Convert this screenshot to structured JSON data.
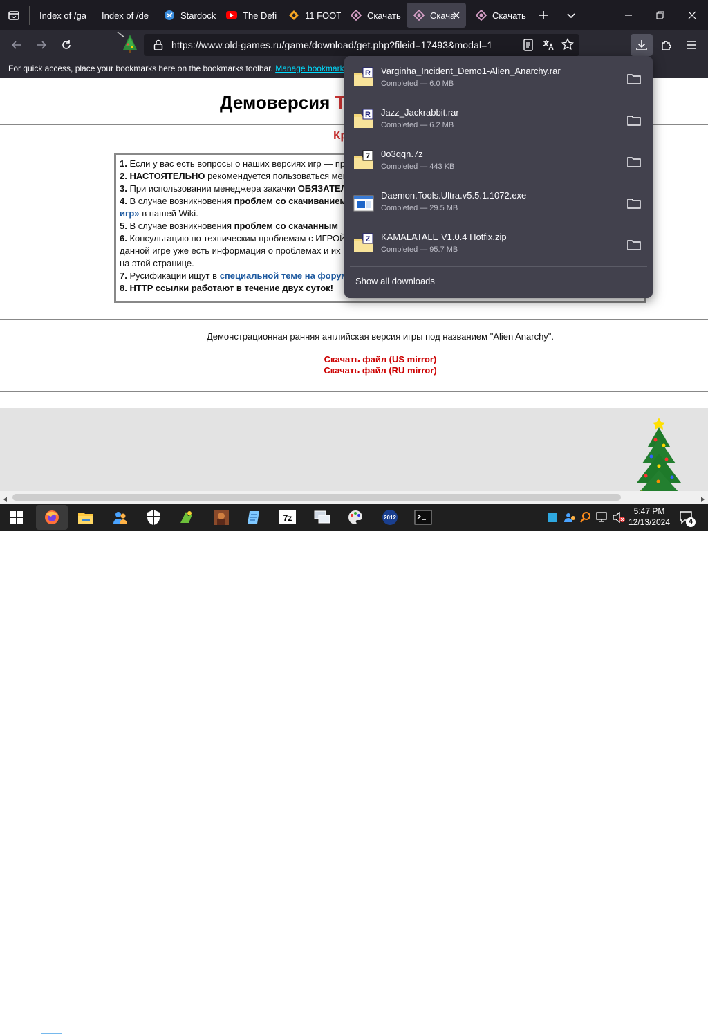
{
  "tabs": [
    {
      "label": "Index of /ga",
      "favicon": "folder-icon"
    },
    {
      "label": "Index of /de",
      "favicon": "folder-icon"
    },
    {
      "label": "Stardock",
      "favicon": "stardock-icon"
    },
    {
      "label": "The Defi",
      "favicon": "youtube-icon"
    },
    {
      "label": "11 FOOT",
      "favicon": "diamond-icon"
    },
    {
      "label": "Скачать",
      "favicon": "old-games-icon"
    },
    {
      "label": "Скача",
      "favicon": "old-games-icon",
      "active": true
    },
    {
      "label": "Скачать",
      "favicon": "old-games-icon"
    }
  ],
  "url": "https://www.old-games.ru/game/download/get.php?fileid=17493&modal=1",
  "bookmarks_bar": {
    "text": "For quick access, place your bookmarks here on the bookmarks toolbar.",
    "link": "Manage bookmarks"
  },
  "page": {
    "title_a": "Демоверсия",
    "title_b": "T",
    "subtitle": "Кр",
    "rules": [
      {
        "num": "1.",
        "text": "Если у вас есть вопросы о наших версиях игр — про"
      },
      {
        "num": "2.",
        "bold": "НАСТОЯТЕЛЬНО",
        "text": " рекомендуется пользоваться мене"
      },
      {
        "num": "3.",
        "text": "При использовании менеджера закачки ",
        "bold": "ОБЯЗАТЕЛ"
      },
      {
        "num": "4.",
        "text": "В случае возникновения ",
        "bold": "проблем со скачиванием"
      },
      {
        "cont": "игр»",
        "text": " в нашей Wiki."
      },
      {
        "num": "5.",
        "text": "В случае возникновения ",
        "bold": "проблем со скачанным"
      },
      {
        "num": "6.",
        "text": "Консультацию по техническим проблемам с ИГРОЙ в"
      },
      {
        "text": "данной игре уже есть информация о проблемах и их ре"
      },
      {
        "text": "на этой странице."
      },
      {
        "num": "7.",
        "text": "Русификации ищут в ",
        "link": "специальной теме на форум"
      },
      {
        "num": "8.",
        "bold": "HTTP ссылки работают в течение двух суток!"
      }
    ],
    "description": "Демонстрационная ранняя английская версия игры под названием \"Alien Anarchy\".",
    "download_us": "Скачать файл (US mirror)",
    "download_ru": "Скачать файл (RU mirror)"
  },
  "downloads": {
    "items": [
      {
        "name": "Varginha_Incident_Demo1-Alien_Anarchy.rar",
        "status": "Completed — 6.0 MB",
        "icon": "rar-archive-icon",
        "badge": "R"
      },
      {
        "name": "Jazz_Jackrabbit.rar",
        "status": "Completed — 6.2 MB",
        "icon": "rar-archive-icon",
        "badge": "R"
      },
      {
        "name": "0o3qqn.7z",
        "status": "Completed — 443 KB",
        "icon": "7z-archive-icon",
        "badge": "7"
      },
      {
        "name": "Daemon.Tools.Ultra.v5.5.1.1072.exe",
        "status": "Completed — 29.5 MB",
        "icon": "exe-file-icon",
        "badge": ""
      },
      {
        "name": "KAMALATALE V1.0.4 Hotfix.zip",
        "status": "Completed — 95.7 MB",
        "icon": "zip-archive-icon",
        "badge": "Z"
      }
    ],
    "show_all": "Show all downloads"
  },
  "taskbar": {
    "time": "5:47 PM",
    "date": "12/13/2024",
    "notification_count": "4"
  },
  "colors": {
    "tabbar_bg": "#1c1b22",
    "toolbar_bg": "#2b2a33",
    "panel_bg": "#42414d",
    "accent_link": "#00ddff",
    "page_red": "#cc0000"
  }
}
